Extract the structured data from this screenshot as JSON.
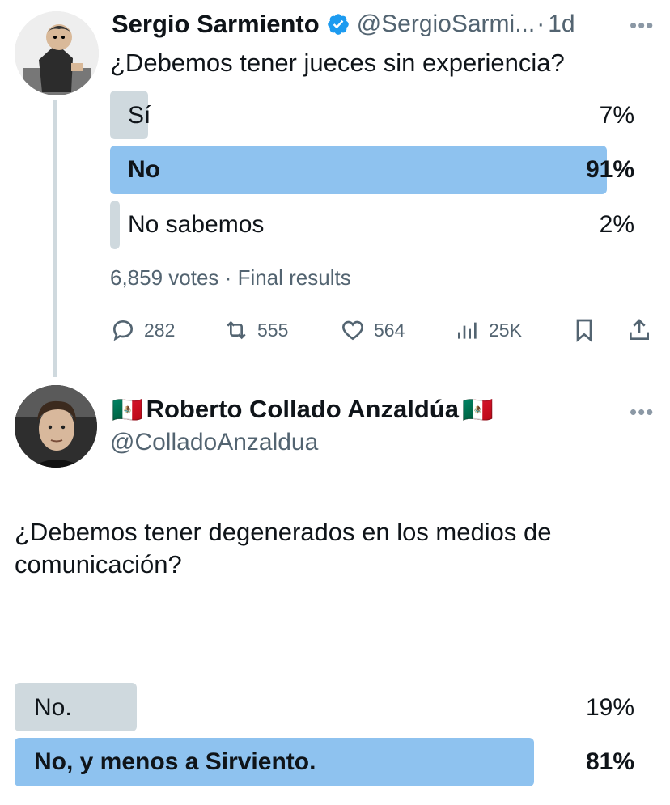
{
  "tweet1": {
    "name": "Sergio Sarmiento",
    "handle": "@SergioSarmi...",
    "time": "1d",
    "sep": "·",
    "text": "¿Debemos tener jueces sin experiencia?",
    "poll": {
      "options": [
        {
          "label": "Sí",
          "pct": "7%",
          "fraction": 0.07,
          "winner": false
        },
        {
          "label": "No",
          "pct": "91%",
          "fraction": 0.91,
          "winner": true
        },
        {
          "label": "No sabemos",
          "pct": "2%",
          "fraction": 0.02,
          "winner": false
        }
      ],
      "votes": "6,859 votes",
      "status": "Final results"
    },
    "actions": {
      "replies": "282",
      "retweets": "555",
      "likes": "564",
      "views": "25K"
    }
  },
  "tweet2": {
    "name": "Roberto Collado Anzaldúa",
    "flag": "🇲🇽",
    "handle": "@ColladoAnzaldua",
    "text": "¿Debemos tener degenerados en los medios de comunicación?",
    "poll": {
      "options": [
        {
          "label": "No.",
          "pct": "19%",
          "fraction": 0.19,
          "winner": false
        },
        {
          "label": "No, y menos a Sirviento.",
          "pct": "81%",
          "fraction": 0.81,
          "winner": true
        }
      ]
    }
  },
  "colors": {
    "winner_bar": "#8ec2ef",
    "loser_bar": "#cfd9de",
    "verified": "#1d9bf0",
    "muted": "#536471"
  }
}
